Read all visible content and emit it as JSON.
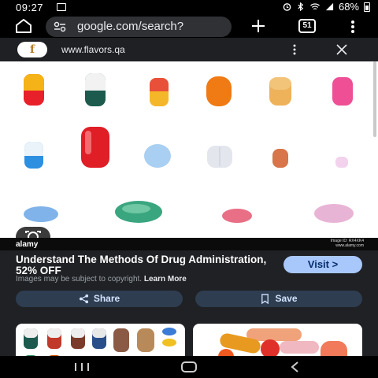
{
  "status_bar": {
    "time": "09:27",
    "battery": "68%",
    "icons": [
      "image-icon",
      "alarm-icon",
      "bluetooth-icon",
      "wifi-icon",
      "signal-icon",
      "battery-icon"
    ]
  },
  "browser": {
    "url": "google.com/search?",
    "tab_count": "51"
  },
  "site_bar": {
    "logo_letter": "f",
    "url": "www.flavors.qa"
  },
  "preview": {
    "watermark_logo": "alamy",
    "image_id": "Image ID: RX4XK4",
    "watermark_site": "www.alamy.com"
  },
  "info": {
    "title": "Understand The Methods Of Drug Administration, 52% OFF",
    "note": "Images may be subject to copyright.",
    "learn_more": "Learn More",
    "visit_label": "Visit",
    "share_label": "Share",
    "save_label": "Save"
  },
  "colors": {
    "accent": "#a8c7fa",
    "button_bg": "#2e3d50",
    "panel_bg": "#202124"
  }
}
